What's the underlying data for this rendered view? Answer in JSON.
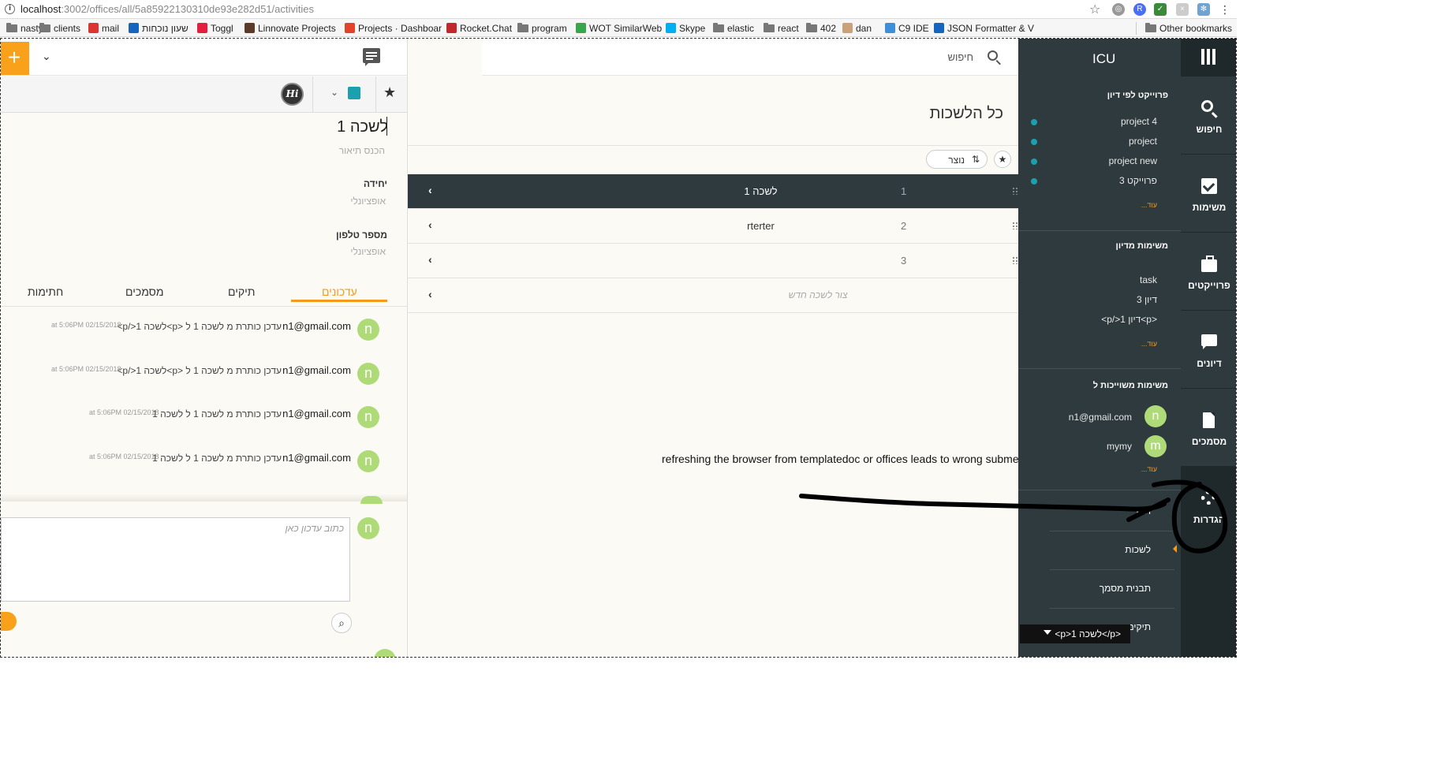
{
  "browser": {
    "url_host": "localhost",
    "url_path": ":3002/offices/all/5a85922130310de93e282d51/activities",
    "bookmarks": [
      {
        "label": "nasty",
        "icon": "folder-icon"
      },
      {
        "label": "clients",
        "icon": "folder-icon"
      },
      {
        "label": "mail",
        "icon": "gmail-icon"
      },
      {
        "label": "שעון נוכחות",
        "icon": "check-icon"
      },
      {
        "label": "Toggl",
        "icon": "toggl-icon"
      },
      {
        "label": "Linnovate Projects",
        "icon": "hash-icon"
      },
      {
        "label": "Projects · Dashboar",
        "icon": "gitlab-icon"
      },
      {
        "label": "Rocket.Chat",
        "icon": "rocket-icon"
      },
      {
        "label": "program",
        "icon": "folder-icon"
      },
      {
        "label": "WOT SimilarWeb",
        "icon": "slack-icon"
      },
      {
        "label": "Skype",
        "icon": "skype-icon"
      },
      {
        "label": "elastic",
        "icon": "folder-icon"
      },
      {
        "label": "react",
        "icon": "folder-icon"
      },
      {
        "label": "402",
        "icon": "folder-icon"
      },
      {
        "label": "dan",
        "icon": "person-icon"
      },
      {
        "label": "C9 IDE",
        "icon": "cloud9-icon"
      },
      {
        "label": "JSON Formatter & V",
        "icon": "check-icon"
      }
    ],
    "other_bookmarks": "Other bookmarks"
  },
  "detail": {
    "title": "לשכה 1",
    "description_placeholder": "הכנס תיאור",
    "unit_label": "יחידה",
    "unit_value": "אופציונלי",
    "phone_label": "מספר טלפון",
    "phone_value": "אופציונלי",
    "avatar_text": "Hi",
    "tabs": [
      "עדכונים",
      "תיקים",
      "מסמכים",
      "חתימות"
    ],
    "updates": [
      {
        "avatar": "n",
        "email": "n1@gmail.com",
        "text": "עדכן כותרת מ לשכה 1 ל <p>לשכה 1</p>",
        "date": "at 5:06PM 02/15/2018"
      },
      {
        "avatar": "n",
        "email": "n1@gmail.com",
        "text": "עדכן כותרת מ לשכה 1 ל <p>לשכה 1</p>",
        "date": "at 5:06PM 02/15/2018"
      },
      {
        "avatar": "n",
        "email": "n1@gmail.com",
        "text": "עדכן כותרת מ לשכה 1 ל לשכה 1",
        "date": "at 5:06PM 02/15/2018"
      },
      {
        "avatar": "n",
        "email": "n1@gmail.com",
        "text": "עדכן כותרת מ לשכה 1 ל לשכה 1",
        "date": "at 5:06PM 02/15/2018"
      }
    ],
    "composer_avatar": "n",
    "composer_placeholder": "כתוב עדכון כאן"
  },
  "list": {
    "search_placeholder": "חיפוש",
    "title": "כל הלשכות",
    "sort_label": "נוצר",
    "rows": [
      {
        "num": "1",
        "name": "לשכה 1"
      },
      {
        "num": "2",
        "name": "rterter"
      },
      {
        "num": "3",
        "name": ""
      }
    ],
    "new_placeholder": "צור לשכה חדש",
    "annotation": "refreshing the browser from templatedoc or offices leads to wrong submenu"
  },
  "sidebar": {
    "brand": "ICU",
    "projects_title": "פרוייקט לפי דיון",
    "projects": [
      "project 4",
      "project",
      "project new",
      "פרוייקט 3"
    ],
    "more": "עוד...",
    "tasks_title": "משימות מדיון",
    "tasks": [
      "task",
      "דיון 3",
      "<p>דיון 1</p>"
    ],
    "assigned_title": "משימות משוייכות ל",
    "people": [
      {
        "avatar": "n",
        "name": "n1@gmail.com"
      },
      {
        "avatar": "m",
        "name": "mymy"
      }
    ],
    "settings_items": [
      "תיק",
      "לשכות",
      "תבנית מסמך",
      "תיקים"
    ],
    "dropdown": "<p>לשכה 1</p>"
  },
  "nav": [
    {
      "label": "חיפוש",
      "icon": "search-icon"
    },
    {
      "label": "משימות",
      "icon": "check-icon"
    },
    {
      "label": "פרוייקטים",
      "icon": "briefcase-icon"
    },
    {
      "label": "דיונים",
      "icon": "chat-icon"
    },
    {
      "label": "מסמכים",
      "icon": "document-icon"
    },
    {
      "label": "הגדרות",
      "icon": "gear-icon"
    }
  ],
  "colors": {
    "accent": "#f59a1b",
    "sidebar": "#2e3a3e",
    "iconbar": "#1f292c",
    "avatar": "#aedb78",
    "teal": "#1aa1ad"
  }
}
